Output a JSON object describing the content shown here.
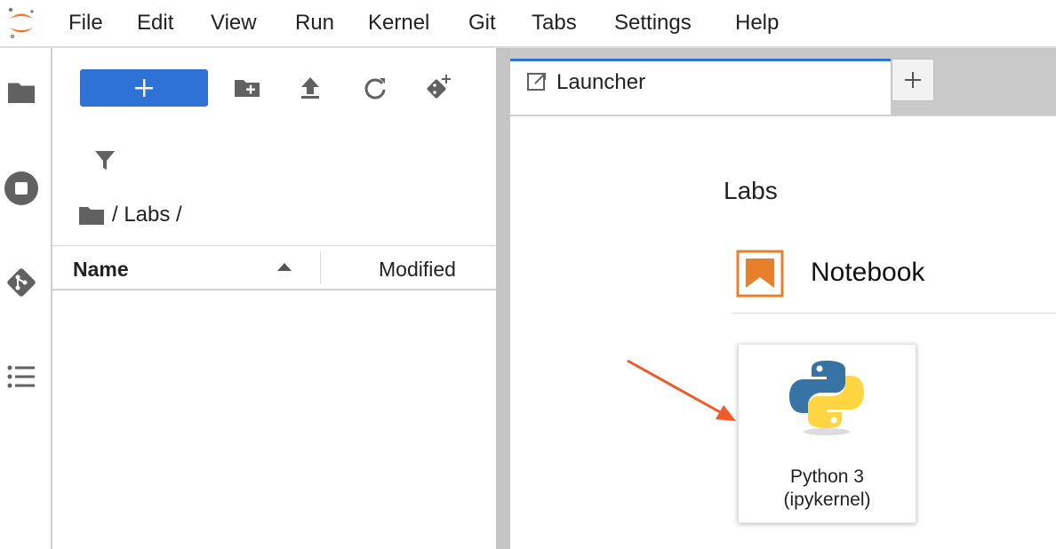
{
  "menubar": {
    "items": [
      "File",
      "Edit",
      "View",
      "Run",
      "Kernel",
      "Git",
      "Tabs",
      "Settings",
      "Help"
    ]
  },
  "activitybar": {
    "icons": [
      "folder-icon",
      "stop-circle-icon",
      "git-icon",
      "list-icon"
    ]
  },
  "filebrowser": {
    "new_button_label": "+",
    "toolbar_icons": [
      "new-folder-icon",
      "upload-icon",
      "refresh-icon",
      "git-clone-icon"
    ],
    "filter_icon": "filter-icon",
    "breadcrumb": "/ Labs /",
    "columns": {
      "name": "Name",
      "modified": "Modified"
    },
    "sort_direction": "ascending"
  },
  "main": {
    "tabs": [
      {
        "label": "Launcher",
        "active": true
      }
    ],
    "add_tab_label": "+",
    "launcher": {
      "section_title": "Labs",
      "section_item": "Notebook",
      "kernel_card": {
        "line1": "Python 3",
        "line2": "(ipykernel)"
      }
    }
  },
  "colors": {
    "accent": "#2f72d6",
    "notebook_orange": "#e8802b",
    "arrow": "#f05a28",
    "python_blue": "#3873a6",
    "python_yellow": "#ffd641"
  }
}
